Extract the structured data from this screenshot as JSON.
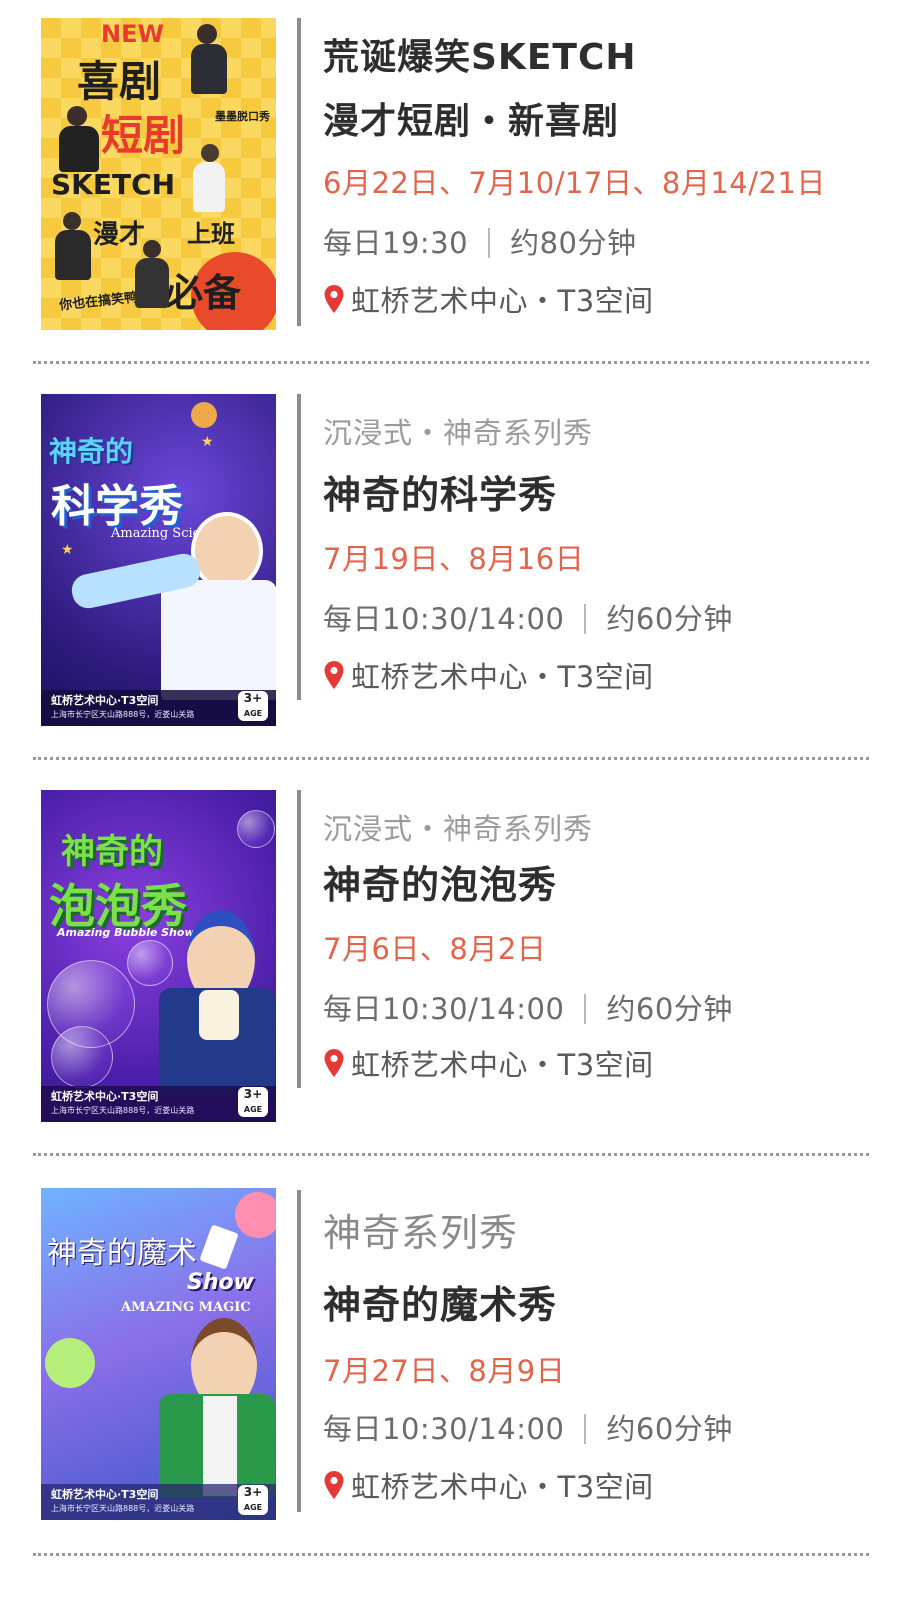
{
  "shows": [
    {
      "title_line1": "荒诞爆笑SKETCH",
      "title_line2": "漫才短剧・新喜剧",
      "dates": "6月22日、7月10/17日、8月14/21日",
      "time": "每日19:30",
      "duration": "约80分钟",
      "venue": "虹桥艺术中心・T3空间",
      "poster": {
        "new": "NEW",
        "line_a": "喜剧",
        "line_b": "短剧",
        "line_c": "SKETCH",
        "line_d": "漫才",
        "line_e": "上班",
        "line_f": "必备",
        "bottom": "你也在搞笑鸭?",
        "brand": "墨墨脱口秀"
      }
    },
    {
      "tagline": "沉浸式・神奇系列秀",
      "title": "神奇的科学秀",
      "dates": "7月19日、8月16日",
      "time": "每日10:30/14:00",
      "duration": "约60分钟",
      "venue": "虹桥艺术中心・T3空间",
      "poster": {
        "title_a": "神奇的",
        "title_b": "科学秀",
        "subtitle": "Amazing Science",
        "venue": "虹桥艺术中心·T3空间",
        "address": "上海市长宁区天山路888号，近娄山关路",
        "age": "3+",
        "age_sub": "AGE"
      }
    },
    {
      "tagline": "沉浸式・神奇系列秀",
      "title": "神奇的泡泡秀",
      "dates": "7月6日、8月2日",
      "time": "每日10:30/14:00",
      "duration": "约60分钟",
      "venue": "虹桥艺术中心・T3空间",
      "poster": {
        "title_a": "神奇的",
        "title_b": "泡泡秀",
        "subtitle": "Amazing Bubble Show",
        "venue": "虹桥艺术中心·T3空间",
        "address": "上海市长宁区天山路888号，近娄山关路",
        "age": "3+",
        "age_sub": "AGE"
      }
    },
    {
      "tagline": "神奇系列秀",
      "title": "神奇的魔术秀",
      "dates": "7月27日、8月9日",
      "time": "每日10:30/14:00",
      "duration": "约60分钟",
      "venue": "虹桥艺术中心・T3空间",
      "poster": {
        "title_a": "神奇的魔术",
        "title_b": "Show",
        "subtitle": "AMAZING MAGIC",
        "venue": "虹桥艺术中心·T3空间",
        "address": "上海市长宁区天山路888号，近娄山关路",
        "age": "3+",
        "age_sub": "AGE"
      }
    }
  ],
  "colors": {
    "date_accent": "#e0654c",
    "title_text": "#2e2e2e",
    "muted_text": "#9b9b9b",
    "pin": "#e53935"
  }
}
